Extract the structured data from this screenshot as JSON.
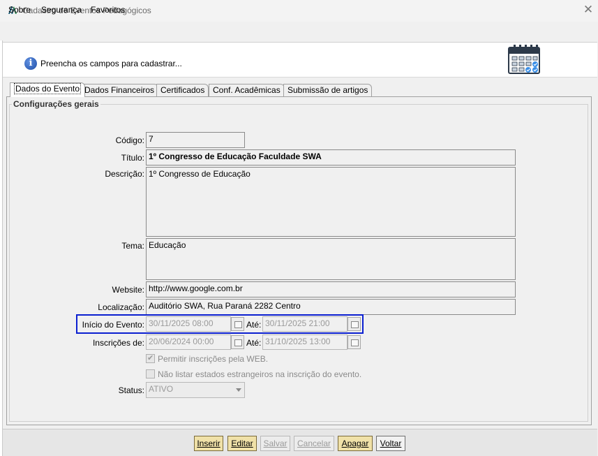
{
  "window": {
    "title": "Cadastro de Eventos Pedagógicos",
    "close_glyph": "✕"
  },
  "menu": {
    "items": [
      "Sobre",
      "Segurança",
      "Favoritos"
    ]
  },
  "header": {
    "info_glyph": "i",
    "message": "Preencha os campos para cadastrar...",
    "icon": "calendar-checklist-icon"
  },
  "tabs": [
    {
      "label": "Dados do Evento",
      "active": true
    },
    {
      "label": "Dados Financeiros",
      "active": false
    },
    {
      "label": "Certificados",
      "active": false
    },
    {
      "label": "Conf. Acadêmicas",
      "active": false
    },
    {
      "label": "Submissão de artigos",
      "active": false
    }
  ],
  "group": {
    "title": "Configurações gerais"
  },
  "form": {
    "codigo": {
      "label": "Código:",
      "value": "7"
    },
    "titulo": {
      "label": "Título:",
      "value": "1º Congresso de Educação Faculdade SWA"
    },
    "descricao": {
      "label": "Descrição:",
      "value": "1º Congresso de Educação"
    },
    "tema": {
      "label": "Tema:",
      "value": "Educação"
    },
    "website": {
      "label": "Website:",
      "value": "http://www.google.com.br"
    },
    "localizacao": {
      "label": "Localização:",
      "value": "Auditório SWA, Rua Paraná 2282 Centro"
    },
    "inicio": {
      "label": "Início do Evento:",
      "from": "30/11/2025 08:00",
      "until_label": "Até:",
      "to": "30/11/2025 21:00"
    },
    "inscricoes": {
      "label": "Inscrições de:",
      "from": "20/06/2024 00:00",
      "until_label": "Até:",
      "to": "31/10/2025 13:00"
    },
    "permitir_web": {
      "label": "Permitir inscrições pela WEB.",
      "checked": true
    },
    "nao_listar": {
      "label": "Não listar estados estrangeiros na inscrição do evento.",
      "checked": false
    },
    "status": {
      "label": "Status:",
      "value": "ATIVO"
    }
  },
  "buttons": {
    "inserir": "Inserir",
    "editar": "Editar",
    "salvar": "Salvar",
    "cancelar": "Cancelar",
    "apagar": "Apagar",
    "voltar": "Voltar"
  },
  "colors": {
    "highlight": "#0b1fd0",
    "primary_button": "#f0e1a8"
  }
}
